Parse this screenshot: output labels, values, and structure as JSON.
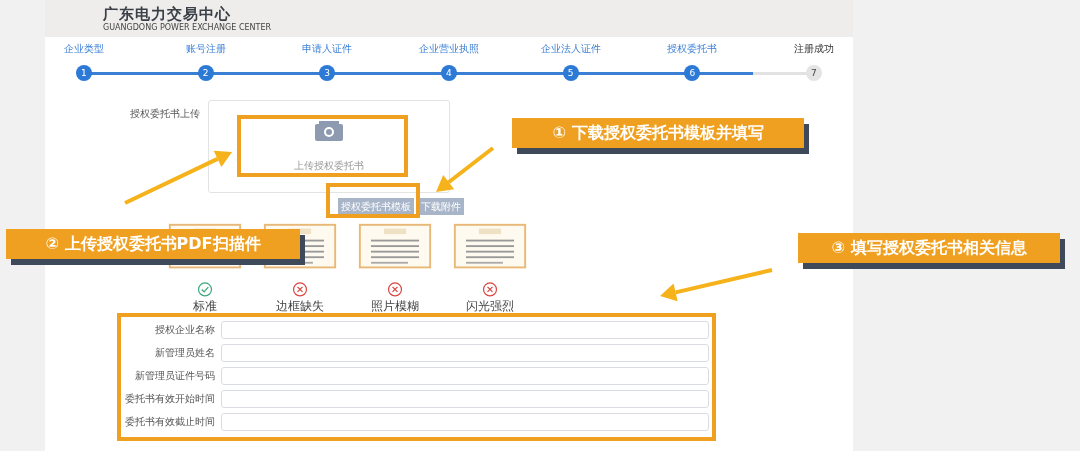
{
  "header": {
    "title": "广东电力交易中心",
    "subtitle": "GUANGDONG POWER EXCHANGE CENTER"
  },
  "steps": [
    {
      "number": "1",
      "label": "企业类型",
      "completed": true
    },
    {
      "number": "2",
      "label": "账号注册",
      "completed": true
    },
    {
      "number": "3",
      "label": "申请人证件",
      "completed": true
    },
    {
      "number": "4",
      "label": "企业营业执照",
      "completed": true
    },
    {
      "number": "5",
      "label": "企业法人证件",
      "completed": true
    },
    {
      "number": "6",
      "label": "授权委托书",
      "completed": true
    },
    {
      "number": "7",
      "label": "注册成功",
      "completed": false
    }
  ],
  "upload": {
    "label": "授权委托书上传",
    "upload_text": "上传授权委托书",
    "buttons": [
      "授权委托书模板",
      "下载附件"
    ]
  },
  "examples": [
    {
      "label": "标准",
      "kind": "ok"
    },
    {
      "label": "边框缺失",
      "kind": "error"
    },
    {
      "label": "照片模糊",
      "kind": "error"
    },
    {
      "label": "闪光强烈",
      "kind": "error"
    }
  ],
  "form": {
    "fields": [
      {
        "label": "授权企业名称"
      },
      {
        "label": "新管理员姓名"
      },
      {
        "label": "新管理员证件号码"
      },
      {
        "label": "委托书有效开始时间"
      },
      {
        "label": "委托书有效截止时间"
      }
    ]
  },
  "callouts": [
    {
      "marker": "①",
      "text": "下载授权委托书模板并填写"
    },
    {
      "marker": "②",
      "text": "上传授权委托书PDF扫描件"
    },
    {
      "marker": "③",
      "text": "填写授权委托书相关信息"
    }
  ]
}
